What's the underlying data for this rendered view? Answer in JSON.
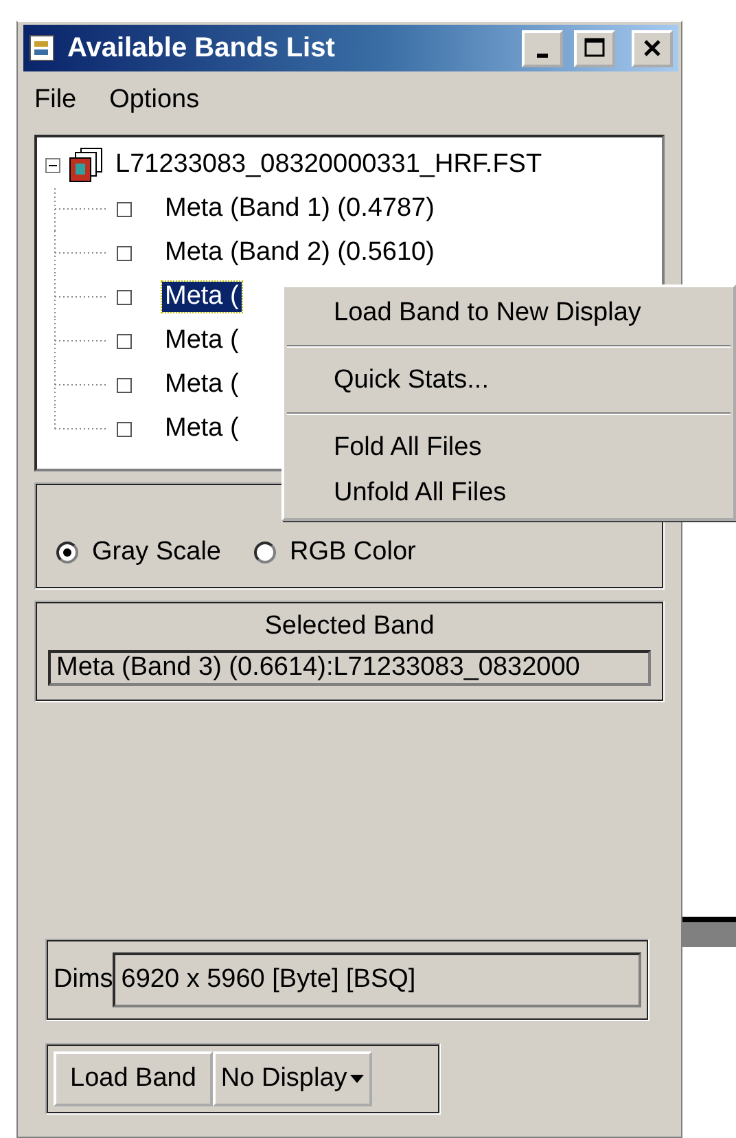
{
  "window": {
    "title": "Available Bands List"
  },
  "menu": [
    "File",
    "Options"
  ],
  "tree": {
    "root": {
      "label": "L71233083_08320000331_HRF.FST",
      "expanded": true,
      "children": [
        {
          "label": "Meta (Band 1) (0.4787)",
          "selected": false
        },
        {
          "label": "Meta (Band 2) (0.5610)",
          "selected": false
        },
        {
          "label": "Meta (",
          "selected": true
        },
        {
          "label": "Meta (",
          "selected": false
        },
        {
          "label": "Meta (",
          "selected": false
        },
        {
          "label": "Meta (",
          "selected": false
        }
      ]
    }
  },
  "context_menu": [
    {
      "kind": "item",
      "label": "Load Band to New Display"
    },
    {
      "kind": "separator"
    },
    {
      "kind": "item",
      "label": "Quick Stats..."
    },
    {
      "kind": "separator"
    },
    {
      "kind": "item",
      "label": "Fold All Files"
    },
    {
      "kind": "item",
      "label": "Unfold All Files"
    }
  ],
  "display_mode": [
    {
      "label": "Gray Scale",
      "selected": true
    },
    {
      "label": "RGB Color",
      "selected": false
    }
  ],
  "selected_band": {
    "title": "Selected Band",
    "value": "Meta (Band 3) (0.6614):L71233083_0832000"
  },
  "dims": {
    "label": "Dims",
    "value": "6920 x 5960 [Byte] [BSQ]"
  },
  "buttons": {
    "load": "Load Band",
    "display": "No Display"
  }
}
